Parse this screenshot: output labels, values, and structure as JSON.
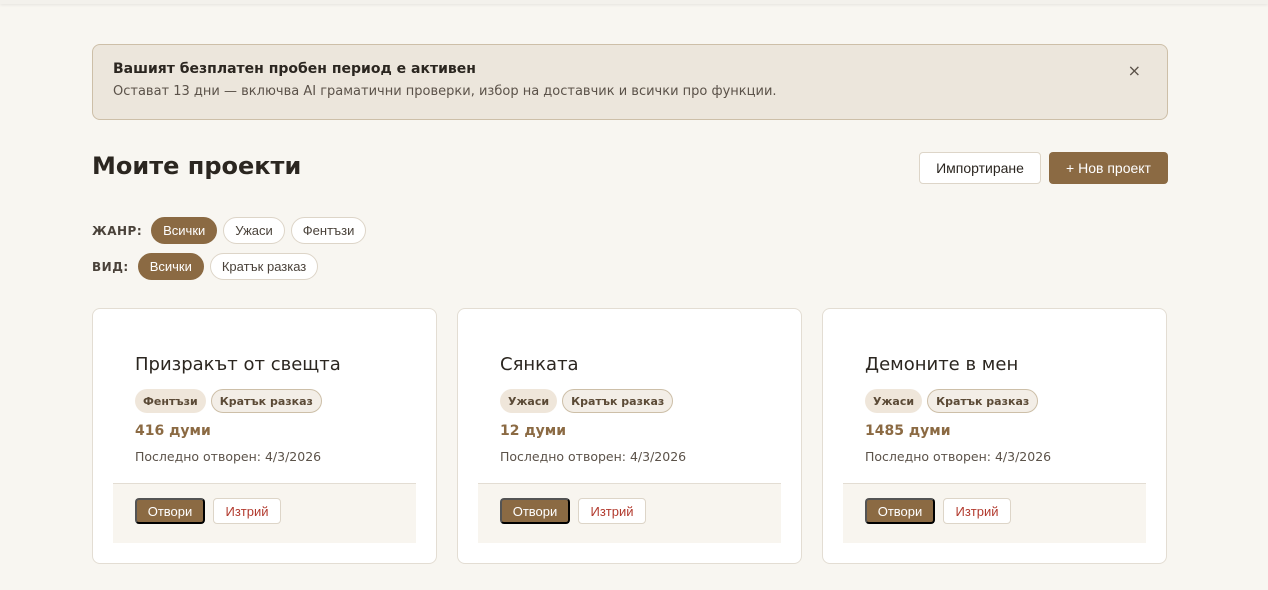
{
  "banner": {
    "title": "Вашият безплатен пробен период е активен",
    "text": "Остават 13 дни — включва AI граматични проверки, избор на доставчик и всички про функции.",
    "close_glyph": "×"
  },
  "header": {
    "title": "Моите проекти",
    "import_label": "Импортиране",
    "new_project_label": "+ Нов проект"
  },
  "filters": {
    "genre": {
      "label": "ЖАНР:",
      "options": [
        "Всички",
        "Ужаси",
        "Фентъзи"
      ],
      "selected": "Всички"
    },
    "kind": {
      "label": "ВИД:",
      "options": [
        "Всички",
        "Кратък разказ"
      ],
      "selected": "Всички"
    }
  },
  "projects": [
    {
      "title": "Призракът от свещта",
      "genre": "Фентъзи",
      "kind": "Кратък разказ",
      "words": "416 думи",
      "last_opened": "Последно отворен: 4/3/2026",
      "open_label": "Отвори",
      "delete_label": "Изтрий"
    },
    {
      "title": "Сянката",
      "genre": "Ужаси",
      "kind": "Кратък разказ",
      "words": "12 думи",
      "last_opened": "Последно отворен: 4/3/2026",
      "open_label": "Отвори",
      "delete_label": "Изтрий"
    },
    {
      "title": "Демоните в мен",
      "genre": "Ужаси",
      "kind": "Кратък разказ",
      "words": "1485 думи",
      "last_opened": "Последно отворен: 4/3/2026",
      "open_label": "Отвори",
      "delete_label": "Изтрий"
    }
  ],
  "colors": {
    "accent": "#8b6a43",
    "background": "#f8f6f1",
    "banner_bg": "#ece6dc",
    "danger": "#b23a2e"
  }
}
